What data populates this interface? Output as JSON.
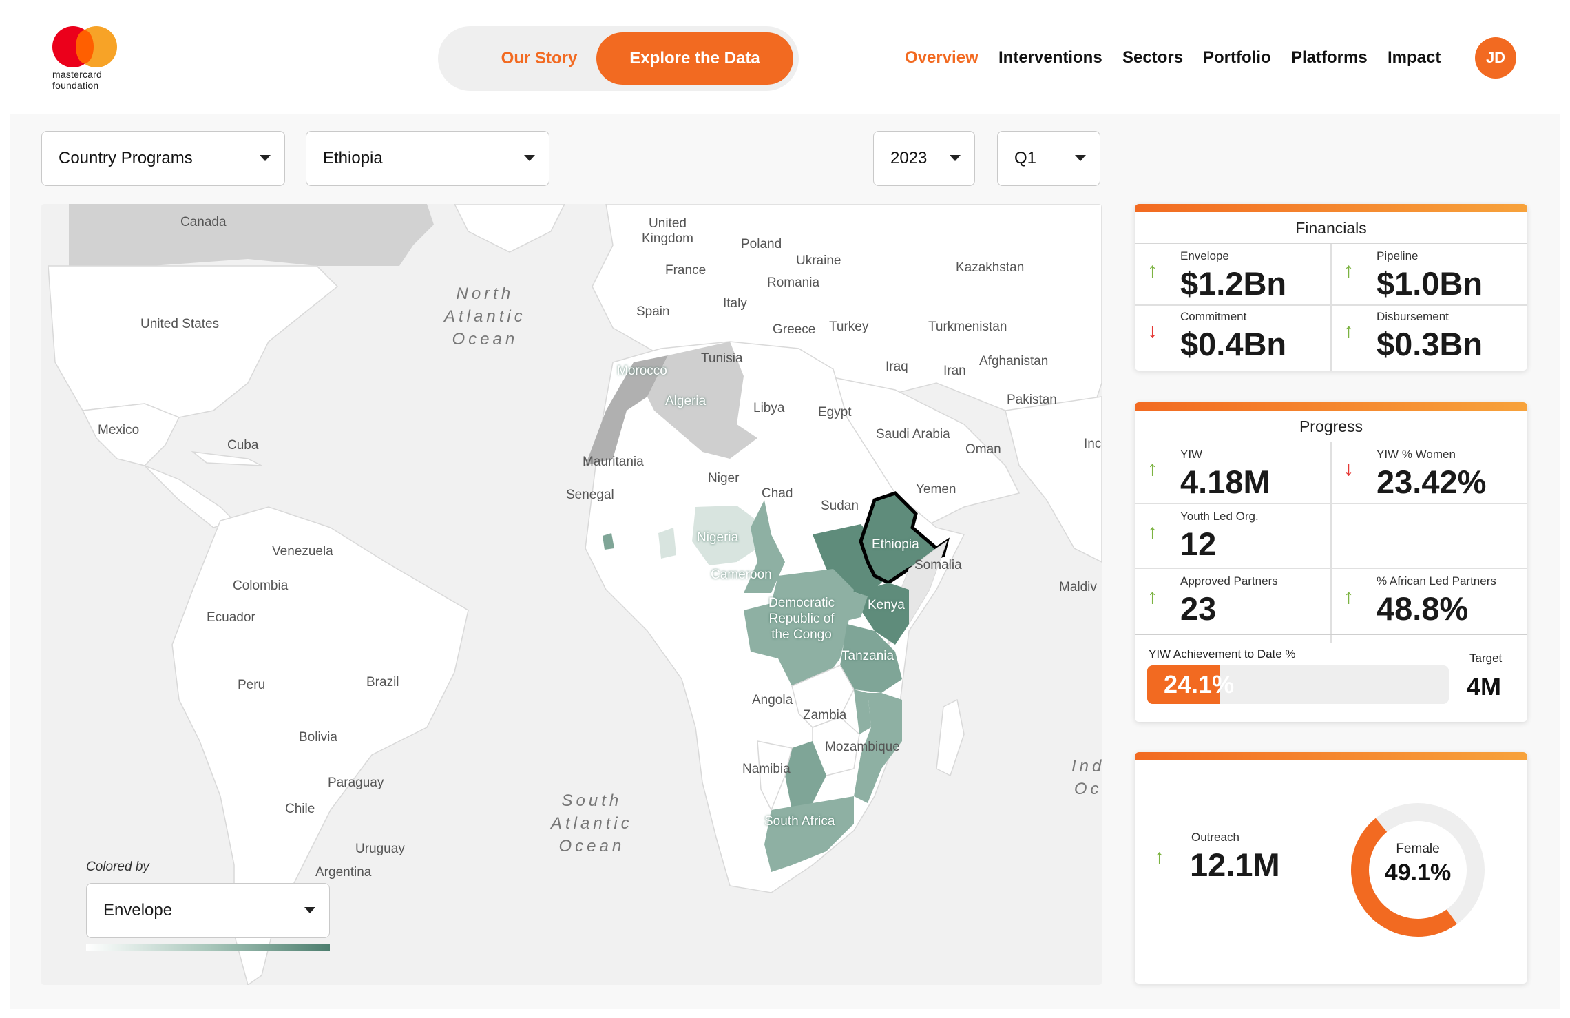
{
  "brand": {
    "logo_text_line1": "mastercard",
    "logo_text_line2": "foundation",
    "accent": "#f26a21"
  },
  "switcher": {
    "option1": "Our Story",
    "option2": "Explore the Data",
    "selected": "Explore the Data"
  },
  "nav": {
    "items": [
      "Overview",
      "Interventions",
      "Sectors",
      "Portfolio",
      "Platforms",
      "Impact"
    ],
    "active": "Overview"
  },
  "user": {
    "initials": "JD"
  },
  "filters": {
    "program": "Country Programs",
    "country": "Ethiopia",
    "year": "2023",
    "quarter": "Q1"
  },
  "map": {
    "highlighted_country": "Ethiopia",
    "colored_by_label": "Colored by",
    "colored_by_value": "Envelope",
    "labels": {
      "canada": "Canada",
      "united_states": "United States",
      "mexico": "Mexico",
      "cuba": "Cuba",
      "venezuela": "Venezuela",
      "colombia": "Colombia",
      "ecuador": "Ecuador",
      "peru": "Peru",
      "brazil": "Brazil",
      "bolivia": "Bolivia",
      "paraguay": "Paraguay",
      "chile": "Chile",
      "uruguay": "Uruguay",
      "argentina": "Argentina",
      "north_atlantic": "North\nAtlantic\nOcean",
      "south_atlantic": "South\nAtlantic\nOcean",
      "indian_ocean": "Ind\nOc",
      "uk": "United\nKingdom",
      "poland": "Poland",
      "ukraine": "Ukraine",
      "france": "France",
      "romania": "Romania",
      "kazakhstan": "Kazakhstan",
      "spain": "Spain",
      "italy": "Italy",
      "greece": "Greece",
      "turkey": "Turkey",
      "turkmenistan": "Turkmenistan",
      "tunisia": "Tunisia",
      "morocco": "Morocco",
      "algeria": "Algeria",
      "libya": "Libya",
      "egypt": "Egypt",
      "iraq": "Iraq",
      "iran": "Iran",
      "afghanistan": "Afghanistan",
      "pakistan": "Pakistan",
      "saudi_arabia": "Saudi Arabia",
      "oman": "Oman",
      "india_partial": "Inc",
      "mauritania": "Mauritania",
      "niger": "Niger",
      "chad": "Chad",
      "senegal": "Senegal",
      "sudan": "Sudan",
      "yemen": "Yemen",
      "nigeria": "Nigeria",
      "ethiopia": "Ethiopia",
      "somalia": "Somalia",
      "cameroon": "Cameroon",
      "maldives": "Maldiv",
      "drc": "Democratic\nRepublic of\nthe Congo",
      "kenya": "Kenya",
      "tanzania": "Tanzania",
      "angola": "Angola",
      "zambia": "Zambia",
      "mozambique": "Mozambique",
      "namibia": "Namibia",
      "south_africa": "South Africa"
    }
  },
  "financials": {
    "title": "Financials",
    "envelope": {
      "label": "Envelope",
      "value": "$1.2Bn",
      "trend": "up"
    },
    "pipeline": {
      "label": "Pipeline",
      "value": "$1.0Bn",
      "trend": "up"
    },
    "commitment": {
      "label": "Commitment",
      "value": "$0.4Bn",
      "trend": "down"
    },
    "disbursement": {
      "label": "Disbursement",
      "value": "$0.3Bn",
      "trend": "up"
    }
  },
  "progress": {
    "title": "Progress",
    "yiw": {
      "label": "YIW",
      "value": "4.18M",
      "trend": "up"
    },
    "yiw_women": {
      "label": "YIW % Women",
      "value": "23.42%",
      "trend": "down"
    },
    "youth_led": {
      "label": "Youth Led Org.",
      "value": "12",
      "trend": "up"
    },
    "approved_partners": {
      "label": "Approved Partners",
      "value": "23",
      "trend": "up"
    },
    "african_led": {
      "label": "% African Led Partners",
      "value": "48.8%",
      "trend": "up"
    },
    "achievement": {
      "label": "YIW Achievement to Date %",
      "value": "24.1%",
      "fraction": 0.241
    },
    "target": {
      "label": "Target",
      "value": "4M"
    }
  },
  "outreach": {
    "label": "Outreach",
    "value": "12.1M",
    "trend": "up",
    "female_label": "Female",
    "female_value": "49.1%",
    "female_fraction": 0.491
  },
  "icons": {
    "up": "↑",
    "down": "↓"
  },
  "colors": {
    "up": "#7cb342",
    "down": "#e53935",
    "map_dark": "#5c8a79",
    "map_mid": "#7fa597",
    "map_light": "#c9d9d2"
  }
}
